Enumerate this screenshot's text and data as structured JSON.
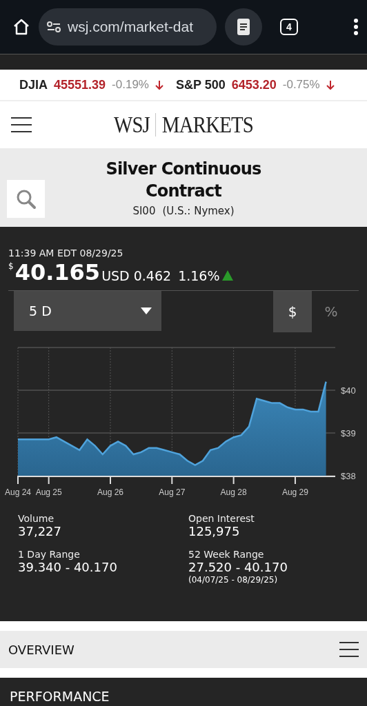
{
  "browser": {
    "url": "wsj.com/market-dat",
    "tab_count": "4"
  },
  "tickers": [
    {
      "name": "DJIA",
      "value": "45551.39",
      "change": "-0.19%"
    },
    {
      "name": "S&P 500",
      "value": "6453.20",
      "change": "-0.75%"
    }
  ],
  "header": {
    "brand": "WSJ",
    "section": "MARKETS"
  },
  "instrument": {
    "title": "Silver Continuous Contract",
    "symbol": "SI00",
    "exchange": "(U.S.: Nymex)"
  },
  "quote": {
    "timestamp": "11:39 AM EDT 08/29/25",
    "currency_symbol": "$",
    "price": "40.165",
    "currency": "USD",
    "change": "0.462",
    "change_percent": "1.16%"
  },
  "range_select": {
    "value": "5 D"
  },
  "units": [
    {
      "label": "$",
      "selected": true
    },
    {
      "label": "%",
      "selected": false
    }
  ],
  "chart_data": {
    "type": "area",
    "categories": [
      "Aug 24",
      null,
      null,
      null,
      "Aug 25",
      null,
      null,
      null,
      null,
      null,
      null,
      null,
      "Aug 26",
      null,
      null,
      null,
      null,
      null,
      null,
      null,
      "Aug 27",
      null,
      null,
      null,
      null,
      null,
      null,
      null,
      "Aug 28",
      null,
      null,
      null,
      null,
      null,
      null,
      null,
      "Aug 29",
      null,
      null,
      null,
      null
    ],
    "series": [
      {
        "color": "#4fa3dc",
        "values": [
          38.85,
          38.85,
          38.85,
          38.85,
          38.85,
          38.9,
          38.8,
          38.7,
          38.6,
          38.85,
          38.7,
          38.5,
          38.7,
          38.8,
          38.7,
          38.5,
          38.55,
          38.65,
          38.65,
          38.6,
          38.55,
          38.5,
          38.35,
          38.25,
          38.35,
          38.6,
          38.65,
          38.8,
          38.9,
          38.95,
          39.15,
          39.8,
          39.75,
          39.7,
          39.7,
          39.6,
          39.55,
          39.55,
          39.5,
          39.5,
          40.2
        ]
      }
    ],
    "ylim": [
      38,
      41
    ],
    "grid": true,
    "yticks": [
      {
        "value": 38,
        "label": "$38"
      },
      {
        "value": 39,
        "label": "$39"
      },
      {
        "value": 40,
        "label": "$40"
      }
    ]
  },
  "stats": [
    {
      "label": "Volume",
      "value": "37,227"
    },
    {
      "label": "Open Interest",
      "value": "125,975"
    },
    {
      "label": "1 Day Range",
      "value": "39.340 - 40.170"
    },
    {
      "label": "52 Week Range",
      "value": "27.520 - 40.170",
      "note": "(04/07/25 - 08/29/25)"
    }
  ],
  "sections": [
    {
      "title": "OVERVIEW",
      "kind": "menu"
    },
    {
      "title": "PERFORMANCE",
      "kind": "dark"
    }
  ]
}
